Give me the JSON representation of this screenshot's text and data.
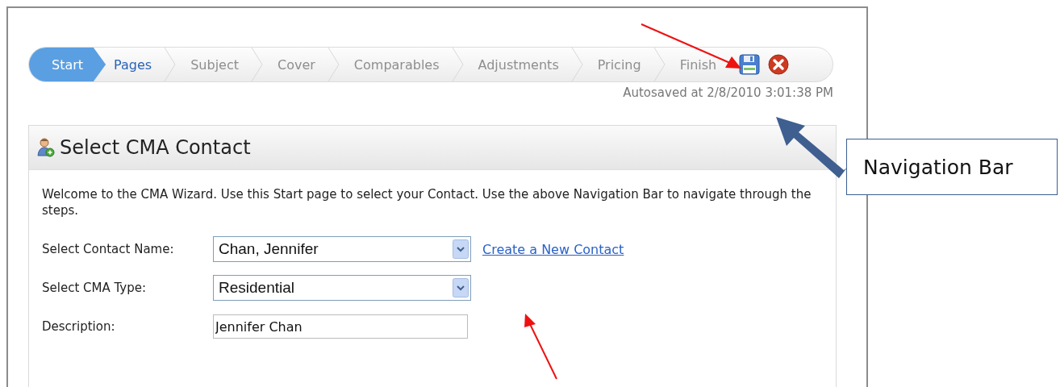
{
  "steps": [
    {
      "label": "Start",
      "selected": true,
      "disabled": false
    },
    {
      "label": "Pages",
      "selected": false,
      "disabled": false
    },
    {
      "label": "Subject",
      "selected": false,
      "disabled": true
    },
    {
      "label": "Cover",
      "selected": false,
      "disabled": true
    },
    {
      "label": "Comparables",
      "selected": false,
      "disabled": true
    },
    {
      "label": "Adjustments",
      "selected": false,
      "disabled": true
    },
    {
      "label": "Pricing",
      "selected": false,
      "disabled": true
    },
    {
      "label": "Finish",
      "selected": false,
      "disabled": true
    }
  ],
  "autosave": "Autosaved at 2/8/2010 3:01:38 PM",
  "panel": {
    "title": "Select CMA Contact",
    "intro": "Welcome to the CMA Wizard. Use this Start page to select your Contact. Use the above Navigation Bar to navigate through the steps.",
    "fields": [
      {
        "kind": "select",
        "label": "Select Contact Name:",
        "value": "Chan, Jennifer",
        "link": "Create a New Contact"
      },
      {
        "kind": "select",
        "label": "Select CMA Type:",
        "value": "Residential"
      },
      {
        "kind": "text",
        "label": "Description:",
        "value": "Jennifer Chan"
      }
    ]
  },
  "callout": {
    "text": "Navigation Bar"
  }
}
